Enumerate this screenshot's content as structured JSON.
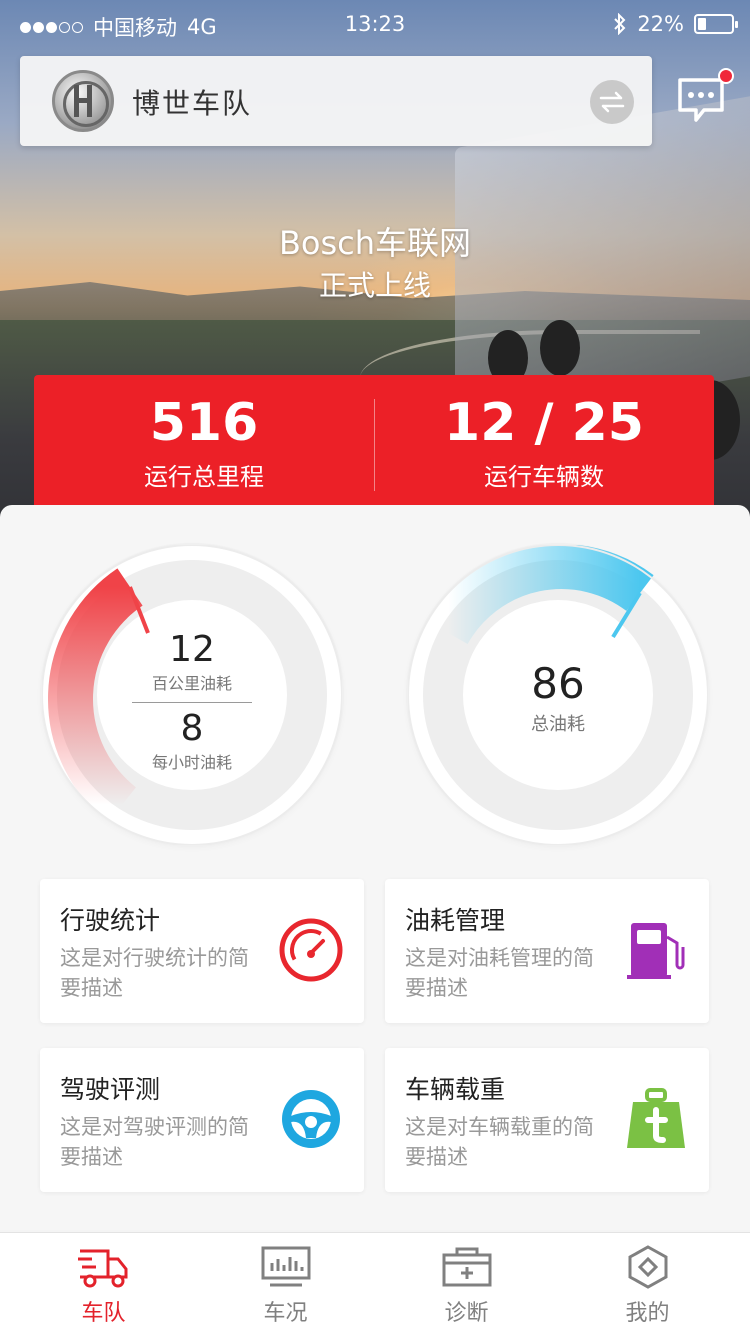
{
  "status_bar": {
    "carrier": "中国移动",
    "network": "4G",
    "time": "13:23",
    "battery_percent": "22%",
    "signal_bars": 3,
    "signal_max": 5
  },
  "header": {
    "team_name": "博世车队",
    "has_unread_messages": true
  },
  "banner": {
    "line1": "Bosch车联网",
    "line2": "正式上线"
  },
  "stats": {
    "mileage_value": "516",
    "mileage_label": "运行总里程",
    "vehicles_value": "12 / 25",
    "vehicles_label": "运行车辆数"
  },
  "gauges": {
    "left": {
      "per100_value": "12",
      "per100_label": "百公里油耗",
      "per_hour_value": "8",
      "per_hour_label": "每小时油耗",
      "color": "#f04348"
    },
    "right": {
      "total_value": "86",
      "total_label": "总油耗",
      "color": "#4cc7ef"
    }
  },
  "cards": [
    {
      "title": "行驶统计",
      "desc": "这是对行驶统计的简要描述",
      "icon": "speedometer-icon",
      "color": "#e8272e"
    },
    {
      "title": "油耗管理",
      "desc": "这是对油耗管理的简要描述",
      "icon": "fuel-pump-icon",
      "color": "#a12fb7"
    },
    {
      "title": "驾驶评测",
      "desc": "这是对驾驶评测的简要描述",
      "icon": "steering-wheel-icon",
      "color": "#1ea7e0"
    },
    {
      "title": "车辆载重",
      "desc": "这是对车辆载重的简要描述",
      "icon": "weight-icon",
      "color": "#7bc144"
    }
  ],
  "tabs": [
    {
      "label": "车队",
      "icon": "truck-icon",
      "active": true
    },
    {
      "label": "车况",
      "icon": "monitor-icon",
      "active": false
    },
    {
      "label": "诊断",
      "icon": "medical-kit-icon",
      "active": false
    },
    {
      "label": "我的",
      "icon": "profile-hexagon-icon",
      "active": false
    }
  ],
  "colors": {
    "brand_red": "#ec2027",
    "tab_active": "#e3222b"
  }
}
